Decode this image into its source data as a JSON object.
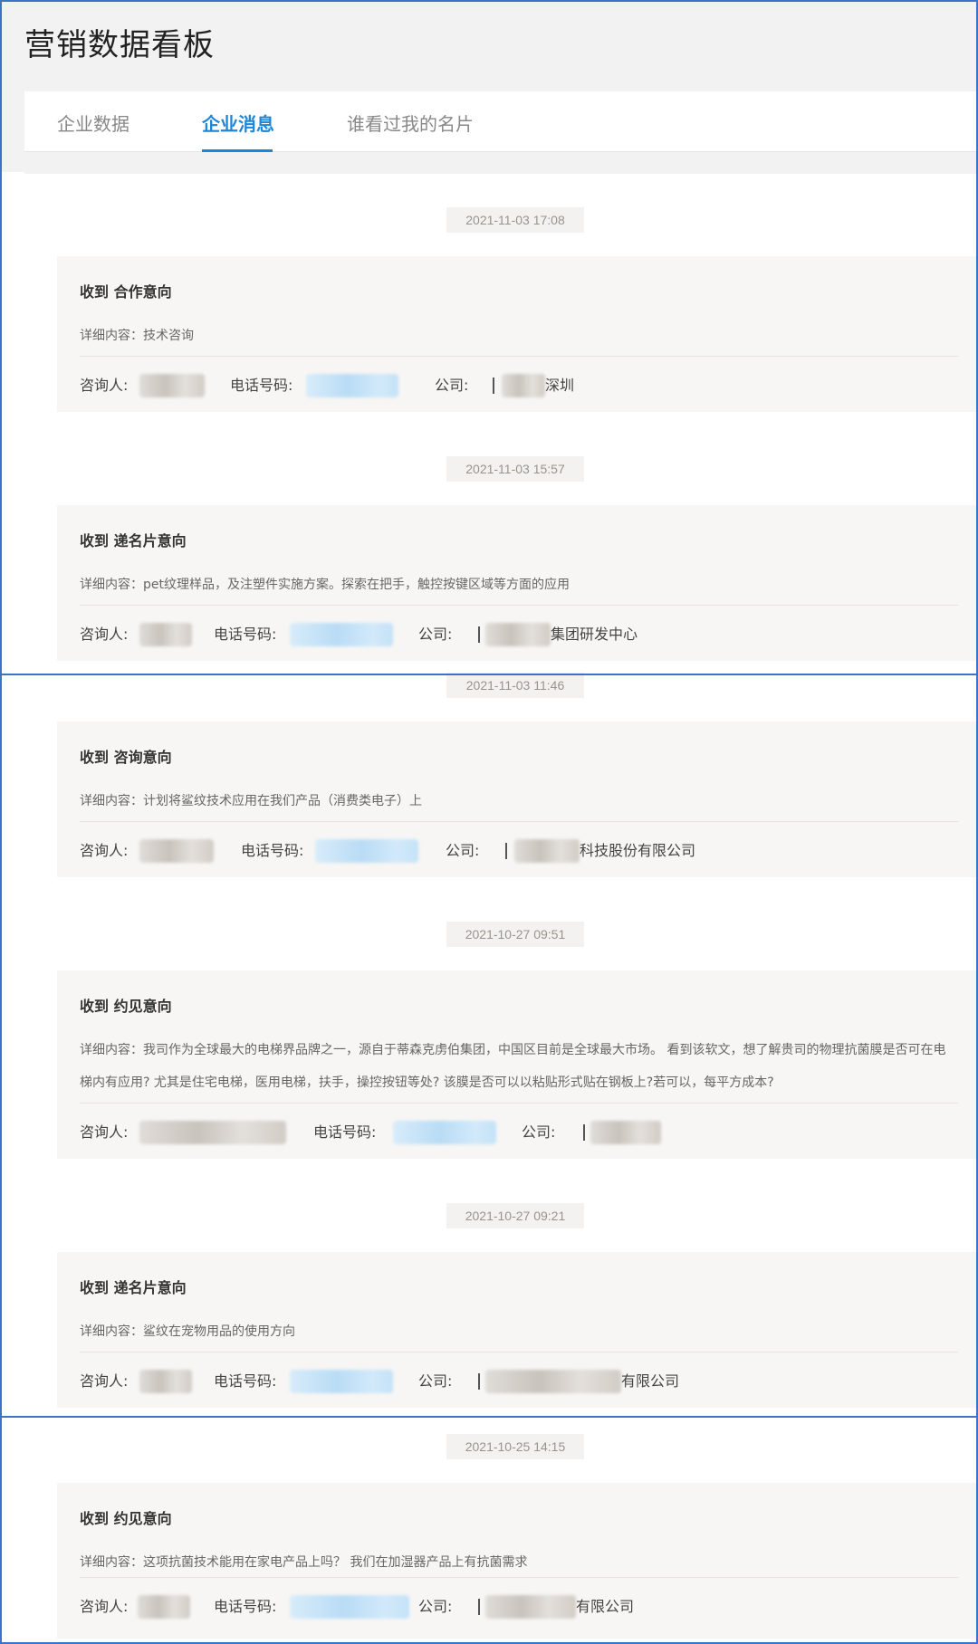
{
  "page_title": "营销数据看板",
  "tabs": [
    {
      "label": "企业数据"
    },
    {
      "label": "企业消息"
    },
    {
      "label": "谁看过我的名片"
    }
  ],
  "labels": {
    "consultant": "咨询人:",
    "phone": "电话号码:",
    "company": "公司:"
  },
  "messages": [
    {
      "timestamp": "2021-11-03 17:08",
      "title": "收到  合作意向",
      "detail": "详细内容：技术咨询",
      "company_visible": "深圳"
    },
    {
      "timestamp": "2021-11-03 15:57",
      "title": "收到  递名片意向",
      "detail": "详细内容：pet纹理样品，及注塑件实施方案。探索在把手，触控按键区域等方面的应用",
      "company_visible": "集团研发中心"
    },
    {
      "timestamp": "2021-11-03 11:46",
      "title": "收到  咨询意向",
      "detail": "详细内容：计划将鲨纹技术应用在我们产品（消费类电子）上",
      "company_visible": "科技股份有限公司"
    },
    {
      "timestamp": "2021-10-27 09:51",
      "title": "收到  约见意向",
      "detail": "详细内容：我司作为全球最大的电梯界品牌之一，源自于蒂森克虏伯集团，中国区目前是全球最大市场。 看到该软文，想了解贵司的物理抗菌膜是否可在电梯内有应用? 尤其是住宅电梯，医用电梯，扶手，操控按钮等处? 该膜是否可以以粘贴形式贴在钢板上?若可以，每平方成本?",
      "company_visible": ""
    },
    {
      "timestamp": "2021-10-27 09:21",
      "title": "收到  递名片意向",
      "detail": "详细内容：鲨纹在宠物用品的使用方向",
      "company_visible": "有限公司"
    },
    {
      "timestamp": "2021-10-25 14:15",
      "title": "收到  约见意向",
      "detail": "详细内容：这项抗菌技术能用在家电产品上吗？ 我们在加湿器产品上有抗菌需求",
      "company_visible": "有限公司"
    }
  ],
  "colors": {
    "accent": "#1e86d6",
    "header_bg": "#f2f2f2",
    "card_bg": "#f7f6f4",
    "timestamp_bg": "#f4f2f0",
    "frame": "#3a73c7"
  }
}
